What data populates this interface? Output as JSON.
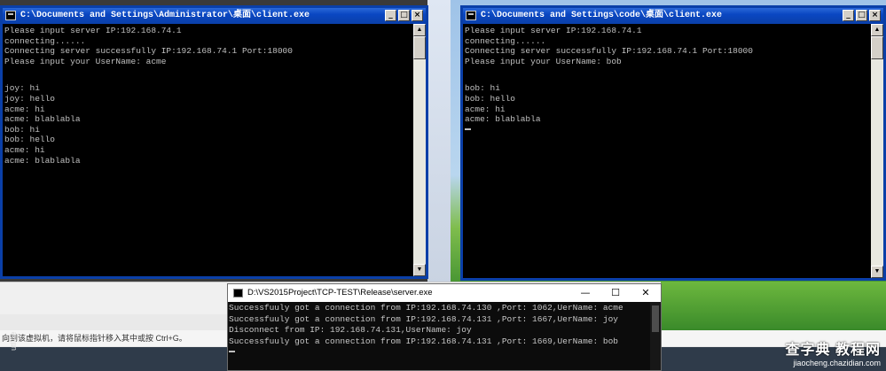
{
  "left_console": {
    "title": "C:\\Documents and Settings\\Administrator\\桌面\\client.exe",
    "lines": [
      "Please input server IP:192.168.74.1",
      "connecting......",
      "Connecting server successfully IP:192.168.74.1 Port:18000",
      "Please input your UserName: acme",
      "",
      "",
      "joy: hi",
      "joy: hello",
      "acme: hi",
      "acme: blablabla",
      "bob: hi",
      "bob: hello",
      "acme: hi",
      "acme: blablabla"
    ]
  },
  "right_console": {
    "title": "C:\\Documents and Settings\\code\\桌面\\client.exe",
    "lines": [
      "Please input server IP:192.168.74.1",
      "connecting......",
      "Connecting server successfully IP:192.168.74.1 Port:18000",
      "Please input your UserName: bob",
      "",
      "",
      "bob: hi",
      "bob: hello",
      "acme: hi",
      "acme: blablabla"
    ]
  },
  "server_console": {
    "title": "D:\\VS2015Project\\TCP-TEST\\Release\\server.exe",
    "lines": [
      "Successfuuly got a connection from IP:192.168.74.130 ,Port: 1062,UerName: acme",
      "Successfuuly got a connection from IP:192.168.74.131 ,Port: 1667,UerName: joy",
      "Disconnect from IP: 192.168.74.131,UserName: joy",
      "Successfuuly got a connection from IP:192.168.74.131 ,Port: 1669,UerName: bob"
    ],
    "minimize_glyph": "—",
    "maximize_glyph": "☐",
    "close_glyph": "✕"
  },
  "xp_buttons": {
    "minimize": "_",
    "maximize": "□",
    "close": "×"
  },
  "host": {
    "hint_text": "向到该虚拟机，请将鼠标指针移入其中或按 Ctrl+G。",
    "outline_label": "utline"
  },
  "watermark": {
    "title": "查字典 教程网",
    "url": "jiaocheng.chazidian.com"
  }
}
